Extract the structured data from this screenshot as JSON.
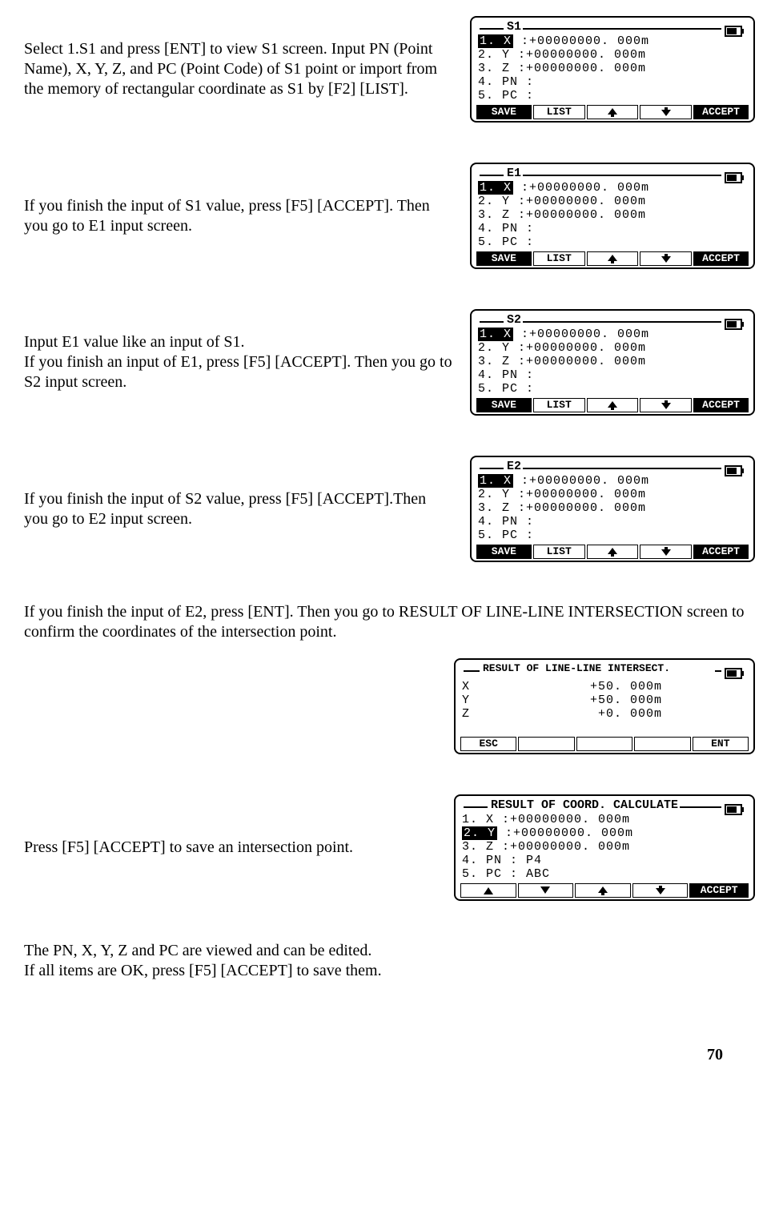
{
  "paragraphs": {
    "p1": "Select 1.S1 and press [ENT] to view S1 screen. Input PN (Point Name), X, Y, Z, and PC (Point Code) of S1 point or import from the memory of rectangular coordinate as S1 by [F2] [LIST].",
    "p2": "If you finish the input of S1 value, press [F5] [ACCEPT]. Then you go to E1 input screen.",
    "p3": "Input E1 value like an input of S1.\nIf you finish an input of E1, press [F5] [ACCEPT]. Then you go to S2 input screen.",
    "p4": "If you finish the input of S2 value, press [F5] [ACCEPT].Then you go to E2 input screen.",
    "p5": "If you finish the input of E2, press [ENT]. Then you go to RESULT OF LINE-LINE INTERSECTION screen to confirm the coordinates of the intersection point.",
    "p6": "Press [F5] [ACCEPT] to save an intersection point.",
    "p7": "The PN, X, Y, Z and PC are viewed and can be edited.\nIf all items are OK, press [F5] [ACCEPT] to save them."
  },
  "screens": {
    "s1": {
      "title": "S1",
      "rows": [
        {
          "label": "1. X ",
          "sel": true,
          "val": ":+00000000. 000m"
        },
        {
          "label": "2. Y ",
          "sel": false,
          "val": ":+00000000. 000m"
        },
        {
          "label": "3. Z ",
          "sel": false,
          "val": ":+00000000. 000m"
        },
        {
          "label": "4. PN",
          "sel": false,
          "val": ":"
        },
        {
          "label": "5. PC",
          "sel": false,
          "val": ":"
        }
      ],
      "softkeys": [
        "SAVE",
        "LIST",
        "UP",
        "DOWN",
        "ACCEPT"
      ]
    },
    "e1": {
      "title": "E1",
      "rows": [
        {
          "label": "1. X ",
          "sel": true,
          "val": ":+00000000. 000m"
        },
        {
          "label": "2. Y ",
          "sel": false,
          "val": ":+00000000. 000m"
        },
        {
          "label": "3. Z ",
          "sel": false,
          "val": ":+00000000. 000m"
        },
        {
          "label": "4. PN",
          "sel": false,
          "val": ":"
        },
        {
          "label": "5. PC",
          "sel": false,
          "val": ":"
        }
      ],
      "softkeys": [
        "SAVE",
        "LIST",
        "UP",
        "DOWN",
        "ACCEPT"
      ]
    },
    "s2": {
      "title": "S2",
      "rows": [
        {
          "label": "1. X ",
          "sel": true,
          "val": ":+00000000. 000m"
        },
        {
          "label": "2. Y ",
          "sel": false,
          "val": ":+00000000. 000m"
        },
        {
          "label": "3. Z ",
          "sel": false,
          "val": ":+00000000. 000m"
        },
        {
          "label": "4. PN",
          "sel": false,
          "val": ":"
        },
        {
          "label": "5. PC",
          "sel": false,
          "val": ":"
        }
      ],
      "softkeys": [
        "SAVE",
        "LIST",
        "UP",
        "DOWN",
        "ACCEPT"
      ]
    },
    "e2": {
      "title": "E2",
      "rows": [
        {
          "label": "1. X ",
          "sel": true,
          "val": ":+00000000. 000m"
        },
        {
          "label": "2. Y ",
          "sel": false,
          "val": ":+00000000. 000m"
        },
        {
          "label": "3. Z ",
          "sel": false,
          "val": ":+00000000. 000m"
        },
        {
          "label": "4. PN",
          "sel": false,
          "val": ":"
        },
        {
          "label": "5. PC",
          "sel": false,
          "val": ":"
        }
      ],
      "softkeys": [
        "SAVE",
        "LIST",
        "UP",
        "DOWN",
        "ACCEPT"
      ]
    },
    "result_intersect": {
      "title": "RESULT OF LINE-LINE INTERSECT.",
      "lines": [
        "X               +50. 000m",
        "Y               +50. 000m",
        "Z                +0. 000m"
      ],
      "softkeys": [
        "ESC",
        "",
        "",
        "",
        "ENT"
      ]
    },
    "result_coord": {
      "title": "RESULT OF COORD. CALCULATE",
      "rows": [
        {
          "label": "1. X ",
          "sel": false,
          "val": ":+00000000. 000m"
        },
        {
          "label": "2. Y ",
          "sel": true,
          "val": ":+00000000. 000m"
        },
        {
          "label": "3. Z ",
          "sel": false,
          "val": ":+00000000. 000m"
        },
        {
          "label": "4. PN",
          "sel": false,
          "val": ": P4"
        },
        {
          "label": "5. PC",
          "sel": false,
          "val": ": ABC"
        }
      ],
      "softkeys": [
        "TUP",
        "TDOWN",
        "UP",
        "DOWN",
        "ACCEPT"
      ]
    }
  },
  "page_number": "70"
}
